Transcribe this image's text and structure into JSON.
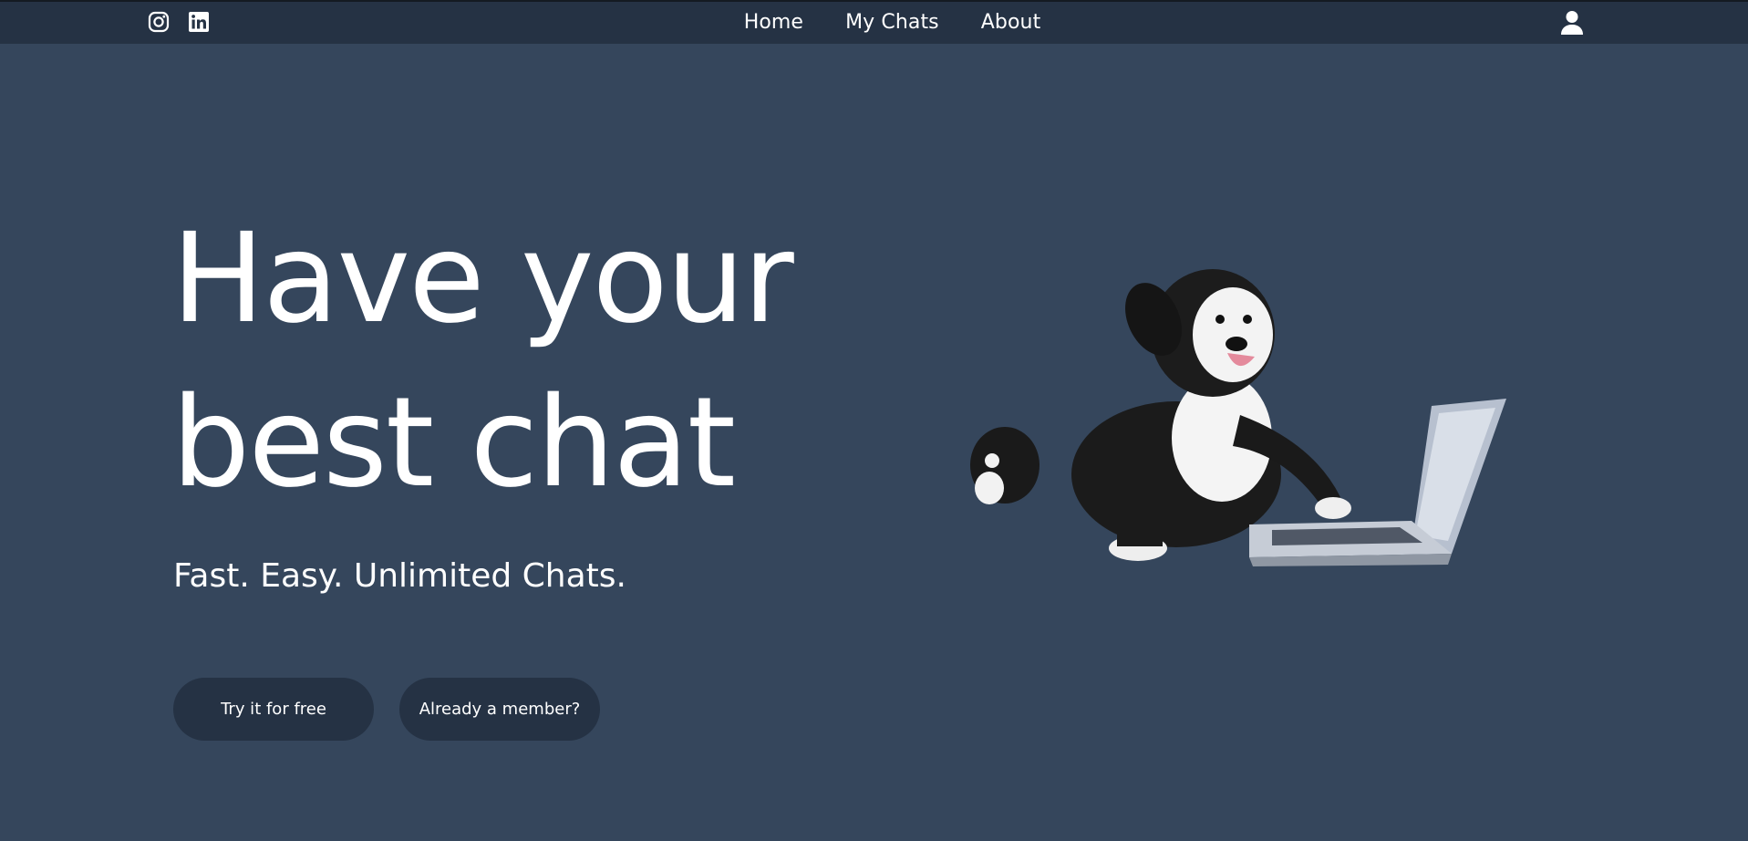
{
  "header": {
    "nav": [
      {
        "label": "Home"
      },
      {
        "label": "My Chats"
      },
      {
        "label": "About"
      }
    ],
    "social_icons": [
      "instagram-icon",
      "linkedin-icon"
    ],
    "account_icon": "user-icon"
  },
  "hero": {
    "title_line1": "Have your",
    "title_line2": "best chat",
    "tagline": "Fast. Easy. Unlimited Chats.",
    "cta_primary": "Try it for free",
    "cta_secondary": "Already a member?"
  },
  "colors": {
    "page_bg": "#35465c",
    "header_bg": "#253244",
    "button_bg": "#253244",
    "text": "#ffffff"
  }
}
